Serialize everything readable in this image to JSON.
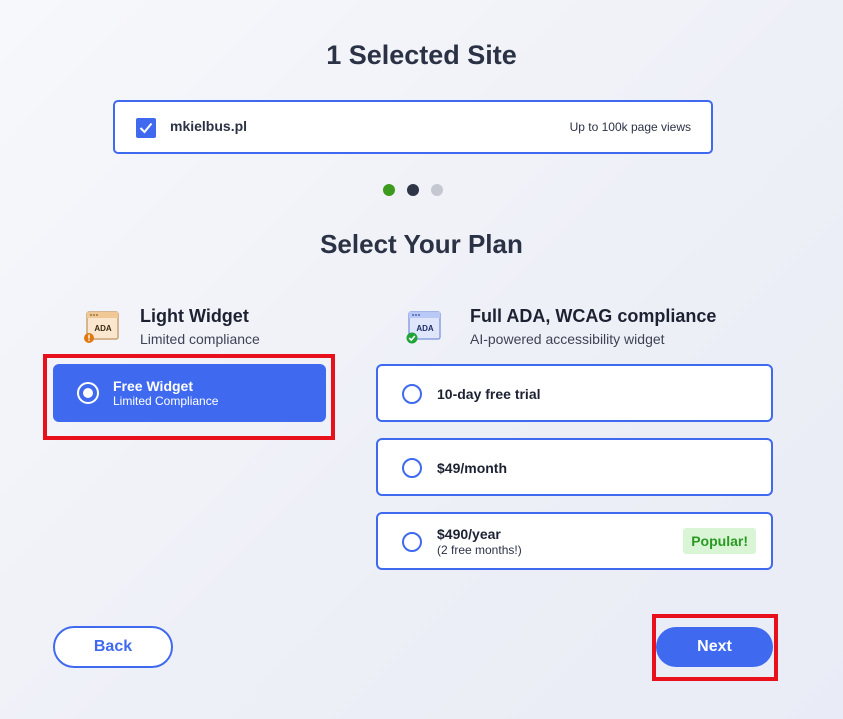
{
  "header": {
    "site_title": "1 Selected Site"
  },
  "site": {
    "name": "mkielbus.pl",
    "page_views": "Up to 100k page views",
    "checked": true
  },
  "steps": {
    "count": 3,
    "states": [
      "complete",
      "current",
      "upcoming"
    ]
  },
  "plan_section": {
    "title": "Select Your Plan"
  },
  "light_plan": {
    "name": "Light Widget",
    "subtitle": "Limited compliance",
    "icon": "ada-warning-icon",
    "icon_text": "ADA",
    "option": {
      "title": "Free Widget",
      "subtitle": "Limited Compliance",
      "selected": true
    }
  },
  "full_plan": {
    "name": "Full ADA, WCAG compliance",
    "subtitle": "AI-powered accessibility widget",
    "icon": "ada-check-icon",
    "icon_text": "ADA",
    "options": [
      {
        "title": "10-day free trial",
        "subtitle": "",
        "selected": false
      },
      {
        "title": "$49/month",
        "subtitle": "",
        "selected": false
      },
      {
        "title": "$490/year",
        "subtitle": "(2 free months!)",
        "badge": "Popular!",
        "selected": false
      }
    ]
  },
  "footer": {
    "back_label": "Back",
    "next_label": "Next"
  },
  "colors": {
    "accent": "#3f6af0",
    "step_complete": "#3c9a1e",
    "step_current": "#2e3547",
    "step_upcoming": "#c5c8d1",
    "badge_bg": "#d9f5d6",
    "badge_text": "#2a9a22",
    "highlight": "#e8101a"
  }
}
